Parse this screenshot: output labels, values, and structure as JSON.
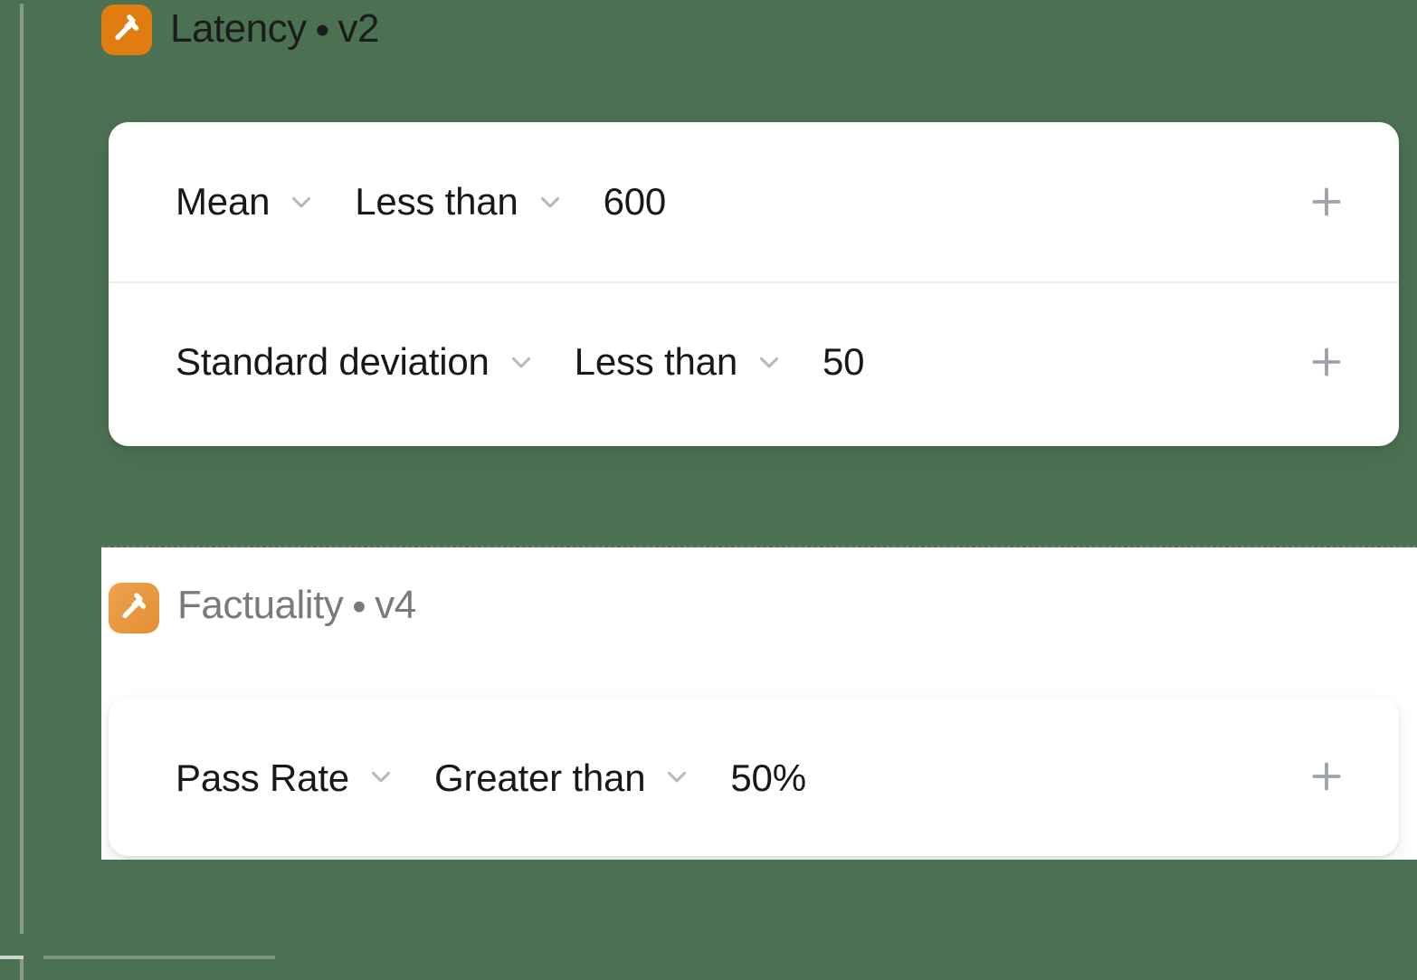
{
  "background_color": "#4c7152",
  "accent_color": "#e07c10",
  "sections": [
    {
      "id": "latency",
      "icon": "gavel-icon",
      "name": "Latency",
      "separator": "•",
      "version": "v2",
      "rules": [
        {
          "metric": "Mean",
          "operator": "Less than",
          "value": "600",
          "add_label": "+"
        },
        {
          "metric": "Standard deviation",
          "operator": "Less than",
          "value": "50",
          "add_label": "+"
        }
      ]
    },
    {
      "id": "factuality",
      "icon": "gavel-icon",
      "name": "Factuality",
      "separator": "•",
      "version": "v4",
      "rules": [
        {
          "metric": "Pass Rate",
          "operator": "Greater than",
          "value": "50%",
          "add_label": "+"
        }
      ]
    }
  ]
}
